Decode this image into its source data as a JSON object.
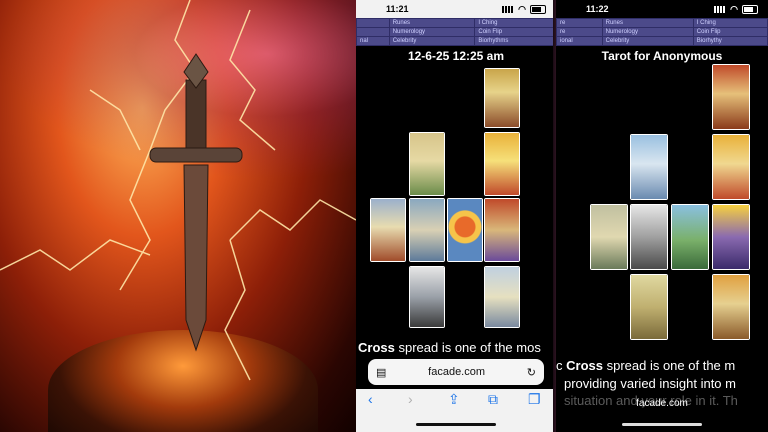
{
  "phone_left": {
    "status_time": "11:21",
    "nav_rows": [
      [
        "",
        "Runes",
        "I Ching"
      ],
      [
        "",
        "Numerology",
        "Coin Flip"
      ],
      [
        "nal",
        "Celebrity",
        "Biorhythms"
      ]
    ],
    "heading": "12-6-25 12:25 am",
    "spread_bold": "Cross",
    "spread_rest": " spread is one of the mos",
    "url": "facade.com"
  },
  "phone_right": {
    "status_time": "11:22",
    "nav_rows": [
      [
        "re",
        "Runes",
        "I Ching"
      ],
      [
        "re",
        "Numerology",
        "Coin Flip"
      ],
      [
        "ional",
        "Celebrity",
        "Biorhythy"
      ]
    ],
    "heading": "Tarot for Anonymous",
    "line1_pre": "c ",
    "line1_bold": "Cross",
    "line1_rest": " spread is one of the m",
    "line2": "providing varied insight into m",
    "line3": "situation and your role in it. Th",
    "url": "facade.com"
  },
  "icons": {
    "reload": "↻",
    "back": "‹",
    "forward": "›",
    "share": "⇪",
    "bookmarks": "⧉",
    "tabs": "❐"
  },
  "colors": {
    "nav_bg": "#4c4a8a",
    "safari_blue": "#1a73e8"
  }
}
